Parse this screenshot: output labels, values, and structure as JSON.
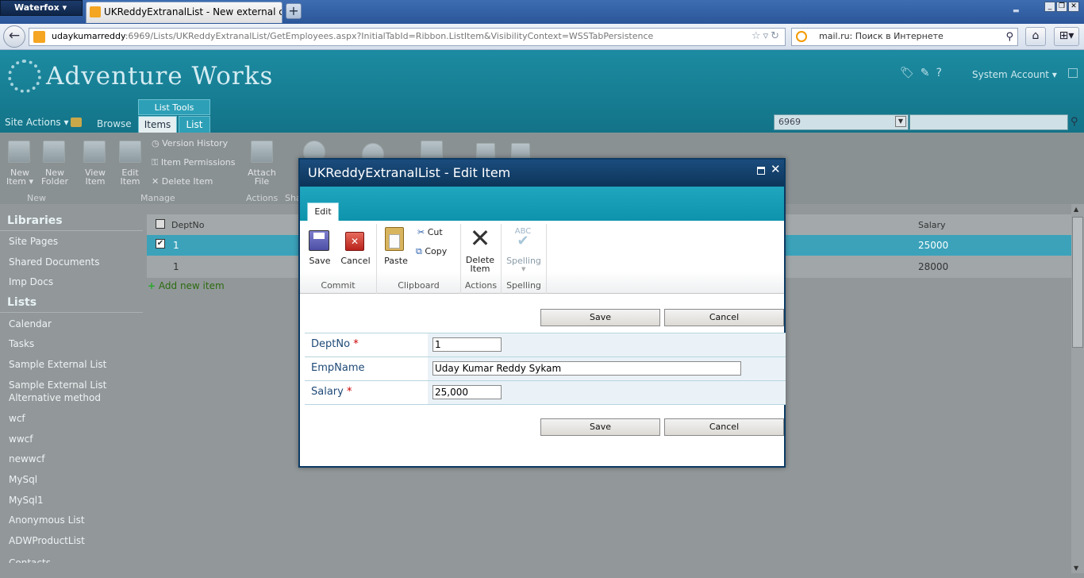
{
  "browser": {
    "app_button": "Waterfox",
    "tab_title": "UKReddyExtranalList - New external content...",
    "new_tab_symbol": "+",
    "url_host": "udaykumarreddy",
    "url_rest": ":6969/Lists/UKReddyExtranalList/GetEmployees.aspx?InitialTabId=Ribbon.ListItem&VisibilityContext=WSSTabPersistence",
    "search_placeholder": "mail.ru: Поиск в Интернете"
  },
  "site": {
    "title": "Adventure Works",
    "user": "System Account",
    "user_arrow": "▾",
    "list_tools": "List Tools",
    "site_actions": "Site Actions ▾",
    "browse_tab": "Browse",
    "items_tab": "Items",
    "list_tab": "List",
    "search_scope": "6969"
  },
  "ribbon": {
    "new_item": [
      "New",
      "Item ▾"
    ],
    "new_folder": [
      "New",
      "Folder"
    ],
    "view_item": [
      "View",
      "Item"
    ],
    "edit_item": [
      "Edit",
      "Item"
    ],
    "version_history": "Version History",
    "item_permissions": "Item Permissions",
    "delete_item": "Delete Item",
    "attach_file": [
      "Attach",
      "File"
    ],
    "group_new": "New",
    "group_manage": "Manage",
    "group_actions": "Actions",
    "group_share": "Sha"
  },
  "quicklaunch": {
    "libraries_heading": "Libraries",
    "libraries": [
      "Site Pages",
      "Shared Documents",
      "Imp Docs"
    ],
    "lists_heading": "Lists",
    "lists": [
      "Calendar",
      "Tasks",
      "Sample External List",
      "Sample External List Alternative method",
      "wcf",
      "wwcf",
      "newwcf",
      "MySql",
      "MySql1",
      "Anonymous List",
      "ADWProductList",
      "Contacts"
    ]
  },
  "list": {
    "columns": {
      "deptno": "DeptNo",
      "salary": "Salary"
    },
    "rows": [
      {
        "deptno": "1",
        "salary": "25000",
        "checked": true
      },
      {
        "deptno": "1",
        "salary": "28000",
        "checked": false
      }
    ],
    "add_new": "Add new item"
  },
  "modal": {
    "title": "UKReddyExtranalList - Edit Item",
    "tab": "Edit",
    "buttons": {
      "save": "Save",
      "cancel": "Cancel",
      "paste": "Paste",
      "cut": "Cut",
      "copy": "Copy",
      "delete": [
        "Delete",
        "Item"
      ],
      "spelling": "Spelling"
    },
    "groups": {
      "commit": "Commit",
      "clipboard": "Clipboard",
      "actions": "Actions",
      "spelling": "Spelling"
    },
    "form": {
      "save": "Save",
      "cancel": "Cancel",
      "fields": [
        {
          "label": "DeptNo",
          "required": true,
          "value": "1"
        },
        {
          "label": "EmpName",
          "required": false,
          "value": "Uday Kumar Reddy Sykam"
        },
        {
          "label": "Salary",
          "required": true,
          "value": "25,000"
        }
      ],
      "required_mark": "*"
    }
  }
}
